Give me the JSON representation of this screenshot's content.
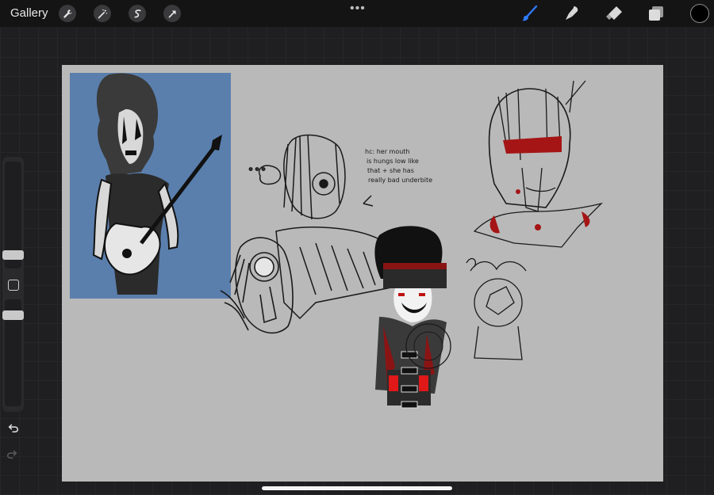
{
  "toolbar": {
    "gallery_label": "Gallery",
    "more_label": "•••",
    "icons": [
      "wrench-icon",
      "magic-wand-icon",
      "selection-icon",
      "transform-arrow-icon",
      "brush-icon",
      "smudge-icon",
      "eraser-icon",
      "layers-icon"
    ],
    "active_tool": "brush",
    "accent_color": "#2f7bff",
    "current_color": "#000000"
  },
  "sidebar": {
    "brush_size_level": 0.4,
    "opacity_level": 0.55
  },
  "canvas": {
    "background": "#b9b9b9",
    "panel_color": "#5a7fad",
    "note_text": [
      "hc: her mouth",
      "is hungs low like",
      "that + she has",
      "really bad underbite"
    ]
  }
}
